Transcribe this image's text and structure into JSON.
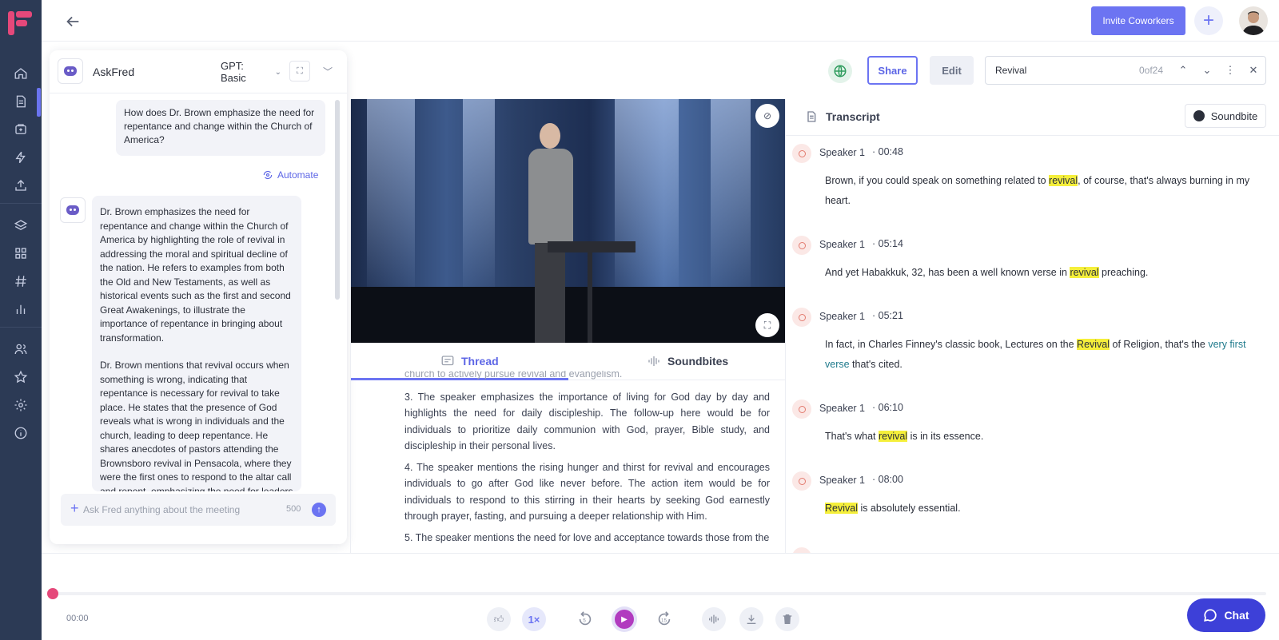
{
  "app": {
    "brand_color": "#e5487a",
    "accent": "#6c74f2"
  },
  "nav": {
    "items": [
      {
        "name": "home",
        "icon": "home-icon"
      },
      {
        "name": "meetings",
        "icon": "document-icon",
        "active": true
      },
      {
        "name": "inbox",
        "icon": "inbox-icon"
      },
      {
        "name": "automations",
        "icon": "bolt-icon"
      },
      {
        "name": "uploads",
        "icon": "upload-icon"
      },
      {
        "name": "layers",
        "icon": "layers-icon"
      },
      {
        "name": "apps",
        "icon": "grid-icon"
      },
      {
        "name": "channels",
        "icon": "hash-icon"
      },
      {
        "name": "analytics",
        "icon": "bar-chart-icon"
      },
      {
        "name": "team",
        "icon": "users-icon"
      },
      {
        "name": "favorites",
        "icon": "star-icon"
      },
      {
        "name": "settings",
        "icon": "gear-icon"
      },
      {
        "name": "help",
        "icon": "info-icon"
      }
    ]
  },
  "topbar": {
    "invite_label": "Invite Coworkers",
    "add_symbol": "+"
  },
  "toolbar": {
    "share_label": "Share",
    "edit_label": "Edit"
  },
  "search": {
    "value": "Revival",
    "count": "0of24"
  },
  "askfred": {
    "title": "AskFred",
    "model": "GPT: Basic",
    "user_message": "How does Dr. Brown emphasize the need for repentance and change within the Church of America?",
    "automate_label": "Automate",
    "bot_paragraphs": [
      "Dr. Brown emphasizes the need for repentance and change within the Church of America by highlighting the role of revival in addressing the moral and spiritual decline of the nation. He refers to examples from both the Old and New Testaments, as well as historical events such as the first and second Great Awakenings, to illustrate the importance of repentance in bringing about transformation.",
      "Dr. Brown mentions that revival occurs when something is wrong, indicating that repentance is necessary for revival to take place. He states that the presence of God reveals what is wrong in individuals and the church, leading to deep repentance. He shares anecdotes of pastors attending the Brownsboro revival in Pensacola, where they were the first ones to respond to the altar call and repent, emphasizing the need for leaders"
    ],
    "input_placeholder": "Ask Fred anything about the meeting",
    "char_limit": "500"
  },
  "tabs": {
    "thread": "Thread",
    "soundbites": "Soundbites"
  },
  "summary": {
    "cut_line": "church to actively pursue revival and evangelism.",
    "points": [
      "3. The speaker emphasizes the importance of living for God day by day and highlights the need for daily discipleship. The follow-up here would be for individuals to prioritize daily communion with God, prayer, Bible study, and discipleship in their personal lives.",
      "4. The speaker mentions the rising hunger and thirst for revival and encourages individuals to go after God like never before. The action item would be for individuals to respond to this stirring in their hearts by seeking God earnestly through prayer, fasting, and pursuing a deeper relationship with Him.",
      "5. The speaker mentions the need for love and acceptance towards those from the"
    ]
  },
  "transcript": {
    "title": "Transcript",
    "soundbite_label": "Soundbite",
    "entries": [
      {
        "speaker": "Speaker 1",
        "time": "· 00:48",
        "pre": "Brown, if you could speak on something related to ",
        "hl": "revival",
        "post": ", of course, that's always burning in my heart."
      },
      {
        "speaker": "Speaker 1",
        "time": "· 05:14",
        "pre": "And yet Habakkuk, 32, has been a well known verse in ",
        "hl": "revival",
        "post": " preaching."
      },
      {
        "speaker": "Speaker 1",
        "time": "· 05:21",
        "pre": "In fact, in Charles Finney's classic book, Lectures on the ",
        "hl": "Revival",
        "post": " of Religion, that's the ",
        "link": "very first verse",
        "post2": " that's cited."
      },
      {
        "speaker": "Speaker 1",
        "time": "· 06:10",
        "pre": "That's what ",
        "hl": "revival",
        "post": " is in its essence."
      },
      {
        "speaker": "Speaker 1",
        "time": "· 08:00",
        "pre": "",
        "hl": "Revival",
        "post": " is absolutely essential."
      }
    ]
  },
  "player": {
    "time": "00:00",
    "speed": "1×",
    "chat_label": "Chat",
    "progress": 0
  }
}
